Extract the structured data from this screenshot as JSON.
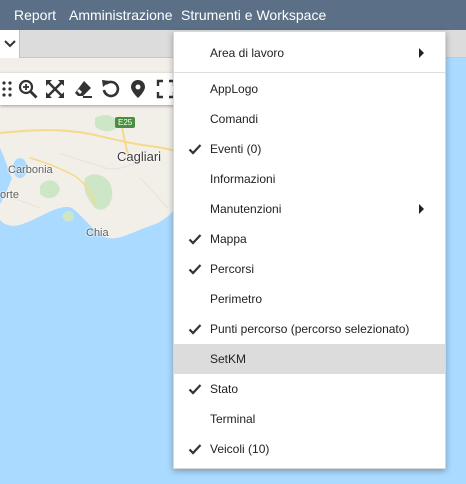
{
  "topbar": {
    "menus": [
      {
        "label": "Report"
      },
      {
        "label": "Amministrazione"
      },
      {
        "label": "Strumenti e Workspace"
      }
    ]
  },
  "map": {
    "labels": {
      "cagliari": "Cagliari",
      "carbonia": "Carbonia",
      "chia": "Chia",
      "porte": "orte",
      "road": "E25"
    },
    "tools": [
      "drag-handle-icon",
      "zoom-in-icon",
      "fit-extent-icon",
      "eraser-icon",
      "undo-icon",
      "pin-icon",
      "fullscreen-icon"
    ]
  },
  "dropdown": {
    "header": {
      "label": "Area di lavoro",
      "has_submenu": true
    },
    "items": [
      {
        "label": "AppLogo",
        "checked": false
      },
      {
        "label": "Comandi",
        "checked": false
      },
      {
        "label": "Eventi (0)",
        "checked": true
      },
      {
        "label": "Informazioni",
        "checked": false
      },
      {
        "label": "Manutenzioni",
        "checked": false,
        "has_submenu": true
      },
      {
        "label": "Mappa",
        "checked": true
      },
      {
        "label": "Percorsi",
        "checked": true
      },
      {
        "label": "Perimetro",
        "checked": false
      },
      {
        "label": "Punti percorso (percorso selezionato)",
        "checked": true
      },
      {
        "label": "SetKM",
        "checked": false,
        "highlighted": true
      },
      {
        "label": "Stato",
        "checked": true
      },
      {
        "label": "Terminal",
        "checked": false
      },
      {
        "label": "Veicoli (10)",
        "checked": true
      }
    ]
  },
  "colors": {
    "topbar": "#5b7086",
    "water": "#aadaff",
    "land": "#f2efe9",
    "highlight": "#dcdcdc"
  }
}
